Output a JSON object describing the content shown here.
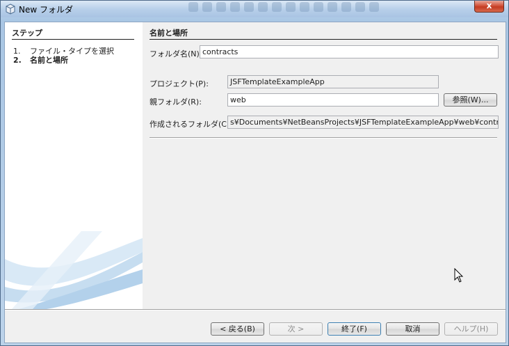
{
  "window": {
    "title": "New フォルダ",
    "close_label": "x"
  },
  "steps": {
    "title": "ステップ",
    "items": [
      {
        "num": "1.",
        "label": "ファイル・タイプを選択"
      },
      {
        "num": "2.",
        "label": "名前と場所"
      }
    ]
  },
  "form": {
    "section_title": "名前と場所",
    "folder_name_label": "フォルダ名(N):",
    "folder_name_value": "contracts",
    "project_label": "プロジェクト(P):",
    "project_value": "JSFTemplateExampleApp",
    "parent_folder_label": "親フォルダ(R):",
    "parent_folder_value": "web",
    "browse_label": "参照(W)...",
    "created_folder_label": "作成されるフォルダ(C):",
    "created_folder_value": "s¥Documents¥NetBeansProjects¥JSFTemplateExampleApp¥web¥contracts"
  },
  "buttons": {
    "back": "< 戻る(B)",
    "next": "次 >",
    "finish": "終了(F)",
    "cancel": "取消",
    "help": "ヘルプ(H)"
  },
  "colors": {
    "accent": "#3c7fb1",
    "swoosh": "#bcd8ee"
  }
}
